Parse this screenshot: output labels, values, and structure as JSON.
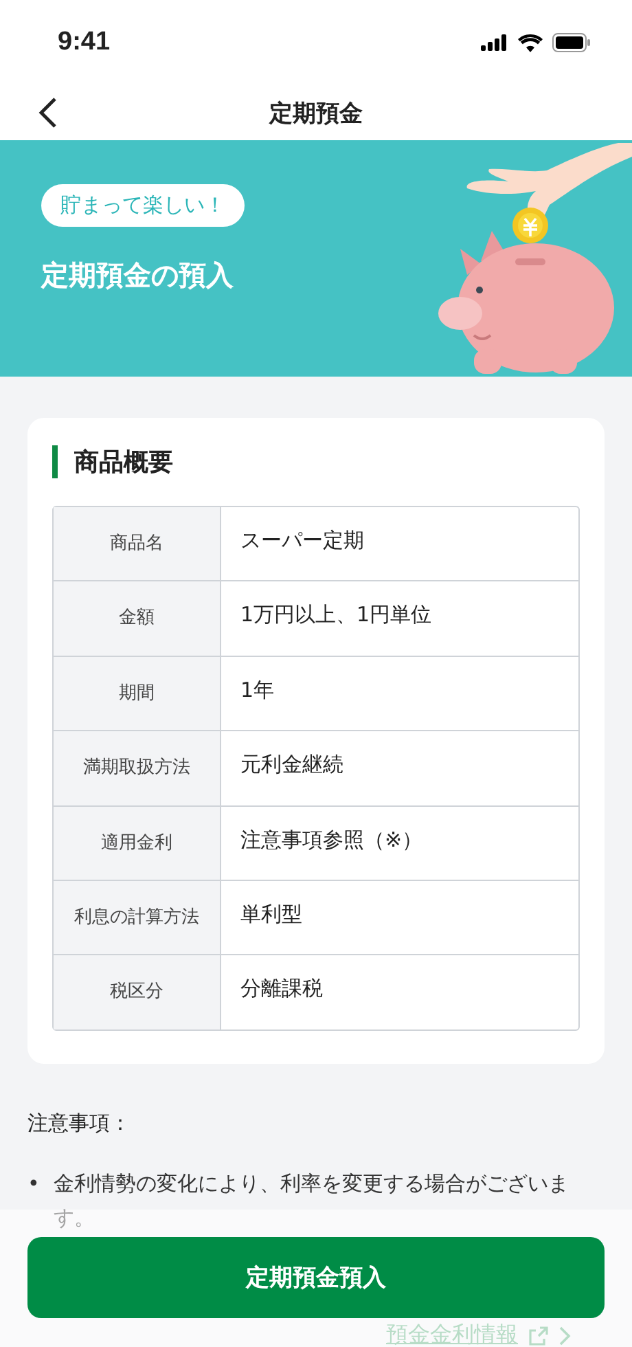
{
  "status_bar": {
    "time": "9:41"
  },
  "nav": {
    "title": "定期預金"
  },
  "banner": {
    "badge": "貯まって楽しい！",
    "title": "定期預金の預入"
  },
  "overview": {
    "heading": "商品概要",
    "rows": [
      {
        "label": "商品名",
        "value": "スーパー定期"
      },
      {
        "label": "金額",
        "value": "1万円以上、1円単位"
      },
      {
        "label": "期間",
        "value": "1年"
      },
      {
        "label": "満期取扱方法",
        "value": "元利金継続"
      },
      {
        "label": "適用金利",
        "value": "注意事項参照（※）"
      },
      {
        "label": "利息の計算方法",
        "value": "単利型"
      },
      {
        "label": "税区分",
        "value": "分離課税"
      }
    ]
  },
  "notes": {
    "heading": "注意事項：",
    "bullet": "•",
    "items": [
      "金利情勢の変化により、利率を変更する場合がございます。"
    ]
  },
  "link": "預金金利情報",
  "primary_button": "定期預金預入"
}
